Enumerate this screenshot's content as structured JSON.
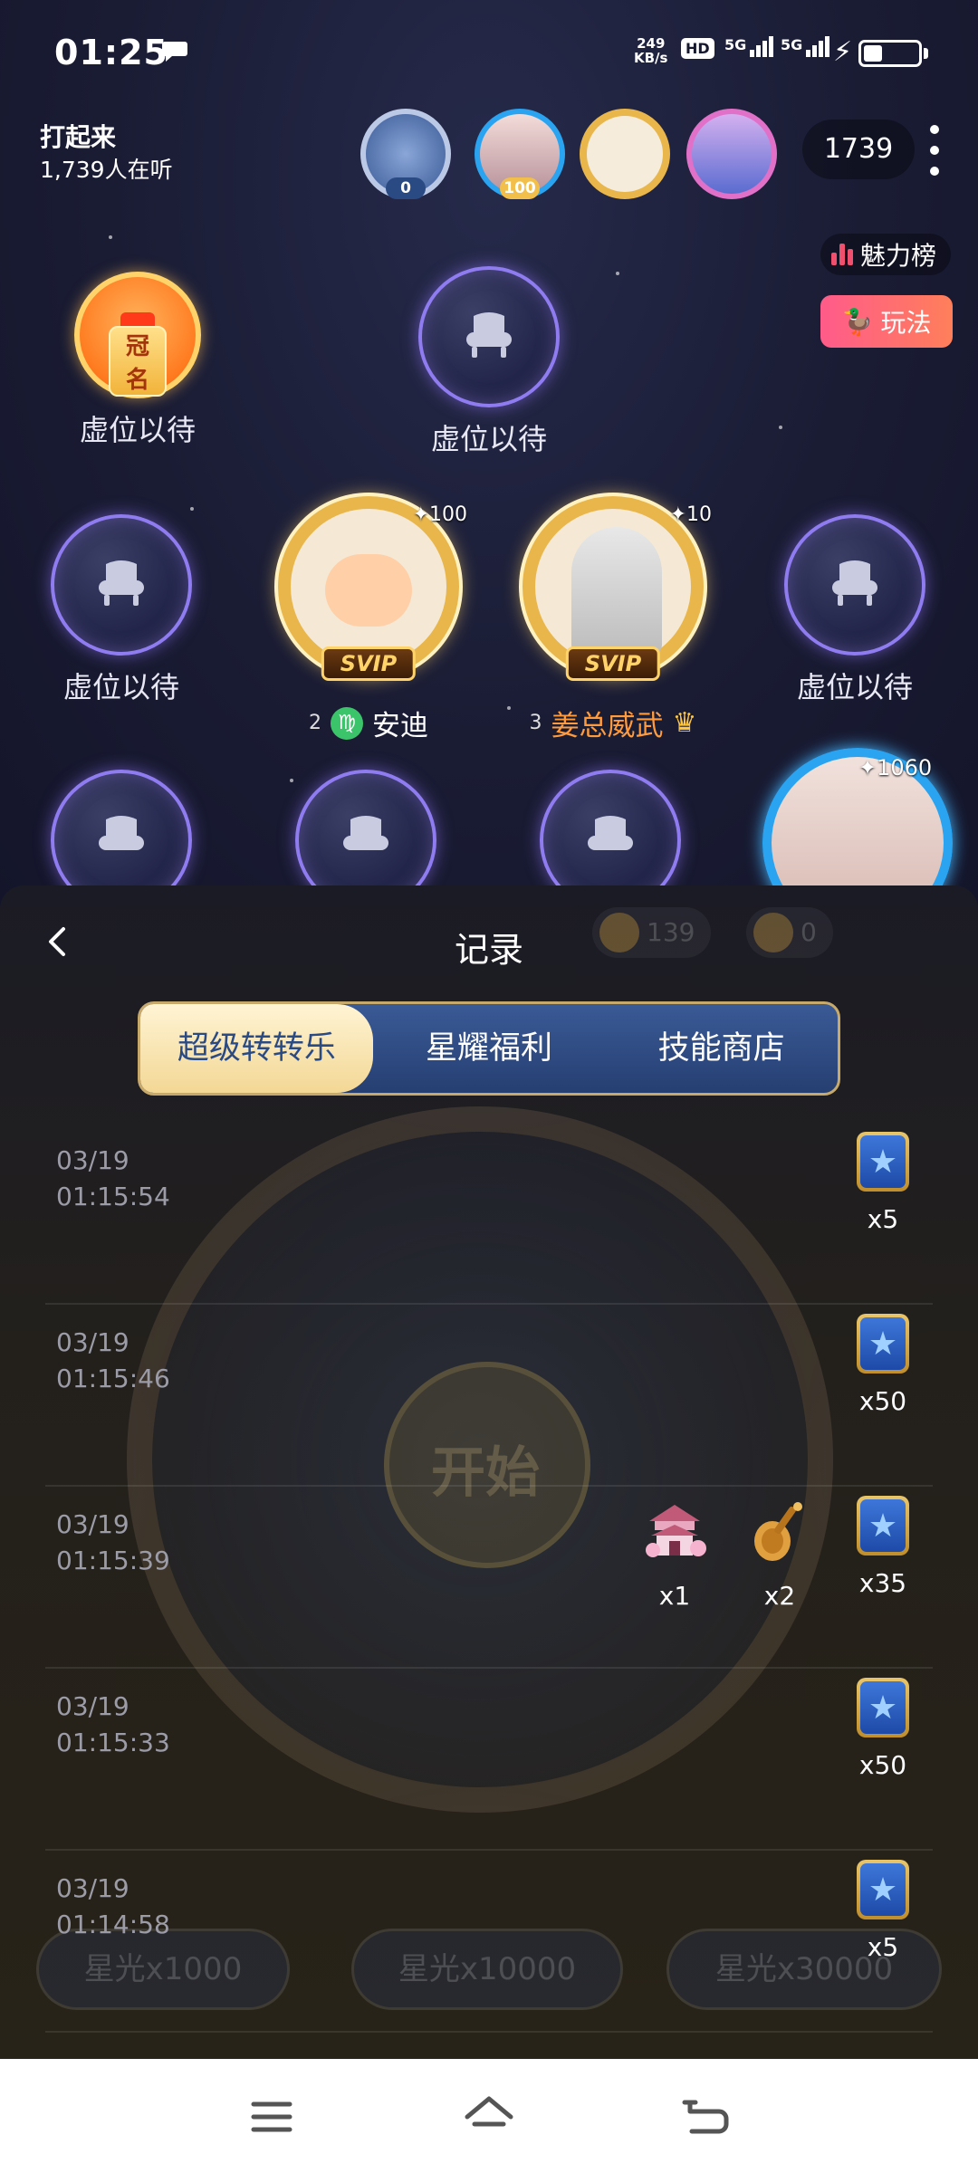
{
  "status_bar": {
    "time": "01:25",
    "net_speed_value": "249",
    "net_speed_unit": "KB/s",
    "hd_label": "HD",
    "sim1_label": "5G",
    "sim2_label": "5G"
  },
  "room": {
    "title": "打起来",
    "listeners": "1,739人在听",
    "top_badge_values": [
      "0",
      "100"
    ],
    "audience_count": "1739",
    "charm_rank_label": "魅力榜",
    "play_label": "玩法",
    "crown_tag": "冠名",
    "empty_seat_label": "虚位以待",
    "vip_label": "SVIP",
    "mic_users": [
      {
        "seat_no": "2",
        "name": "安迪",
        "score": "100",
        "zodiac_icon": "virgo-icon"
      },
      {
        "seat_no": "3",
        "name": "姜总威武",
        "score": "10",
        "name_color": "#ff9b3d"
      }
    ],
    "host_score": "1060"
  },
  "panel": {
    "title": "记录",
    "tabs": [
      {
        "label": "超级转转乐",
        "active": true
      },
      {
        "label": "星耀福利",
        "active": false
      },
      {
        "label": "技能商店",
        "active": false
      }
    ],
    "bg_coin_values": [
      "139",
      "0"
    ],
    "bg_wheel_hub": "开始",
    "bg_buttons": [
      "星光x1000",
      "星光x10000",
      "星光x30000"
    ],
    "records": [
      {
        "date": "03/19",
        "time": "01:15:54",
        "items": [
          {
            "type": "star-card",
            "qty": "x5"
          }
        ]
      },
      {
        "date": "03/19",
        "time": "01:15:46",
        "items": [
          {
            "type": "star-card",
            "qty": "x50"
          }
        ]
      },
      {
        "date": "03/19",
        "time": "01:15:39",
        "items": [
          {
            "type": "pavilion-gift",
            "qty": "x1"
          },
          {
            "type": "pipa-gift",
            "qty": "x2"
          },
          {
            "type": "star-card",
            "qty": "x35"
          }
        ]
      },
      {
        "date": "03/19",
        "time": "01:15:33",
        "items": [
          {
            "type": "star-card",
            "qty": "x50"
          }
        ]
      },
      {
        "date": "03/19",
        "time": "01:14:58",
        "items": [
          {
            "type": "star-card",
            "qty": "x5"
          }
        ]
      }
    ]
  },
  "colors": {
    "accent_gold": "#e9b64b",
    "tab_blue": "#2a4a84",
    "seat_ring": "#8f7cf0",
    "play_button": "#ff5b8a"
  }
}
